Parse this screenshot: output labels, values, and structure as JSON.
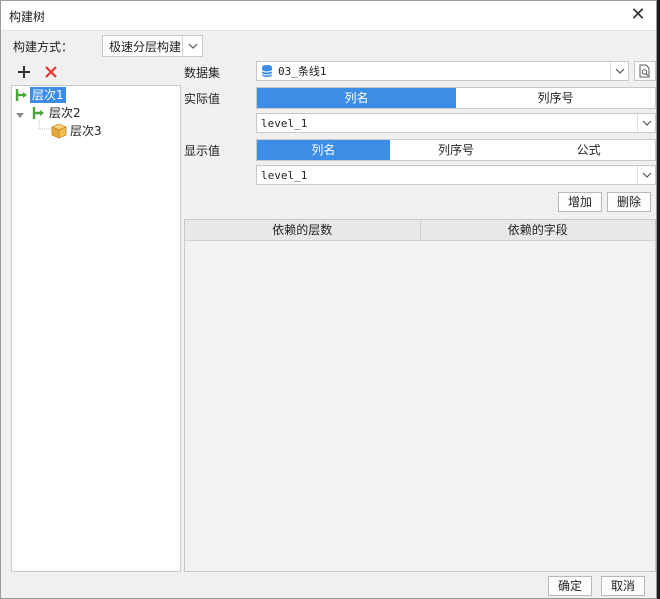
{
  "window": {
    "title": "构建树"
  },
  "method": {
    "label": "构建方式：",
    "value": "极速分层构建"
  },
  "tree": {
    "nodes": [
      {
        "label": "层次1",
        "icon": "hierarchy-icon",
        "selected": true
      },
      {
        "label": "层次2",
        "icon": "hierarchy-icon",
        "selected": false
      },
      {
        "label": "层次3",
        "icon": "cube-icon",
        "selected": false
      }
    ]
  },
  "dataset": {
    "label": "数据集",
    "value": "03_条线1",
    "icon": "database-icon"
  },
  "actual_value": {
    "label": "实际值",
    "options": [
      "列名",
      "列序号"
    ],
    "active": "列名",
    "field": "level_1"
  },
  "display_value": {
    "label": "显示值",
    "options": [
      "列名",
      "列序号",
      "公式"
    ],
    "active": "列名",
    "field": "level_1"
  },
  "buttons": {
    "add": "增加",
    "delete": "删除",
    "ok": "确定",
    "cancel": "取消"
  },
  "table": {
    "columns": [
      "依赖的层数",
      "依赖的字段"
    ]
  },
  "colors": {
    "accent": "#3b8de6",
    "delete": "#e03a2e",
    "hierarchy": "#4aa53a",
    "cube": "#e8a83a"
  }
}
